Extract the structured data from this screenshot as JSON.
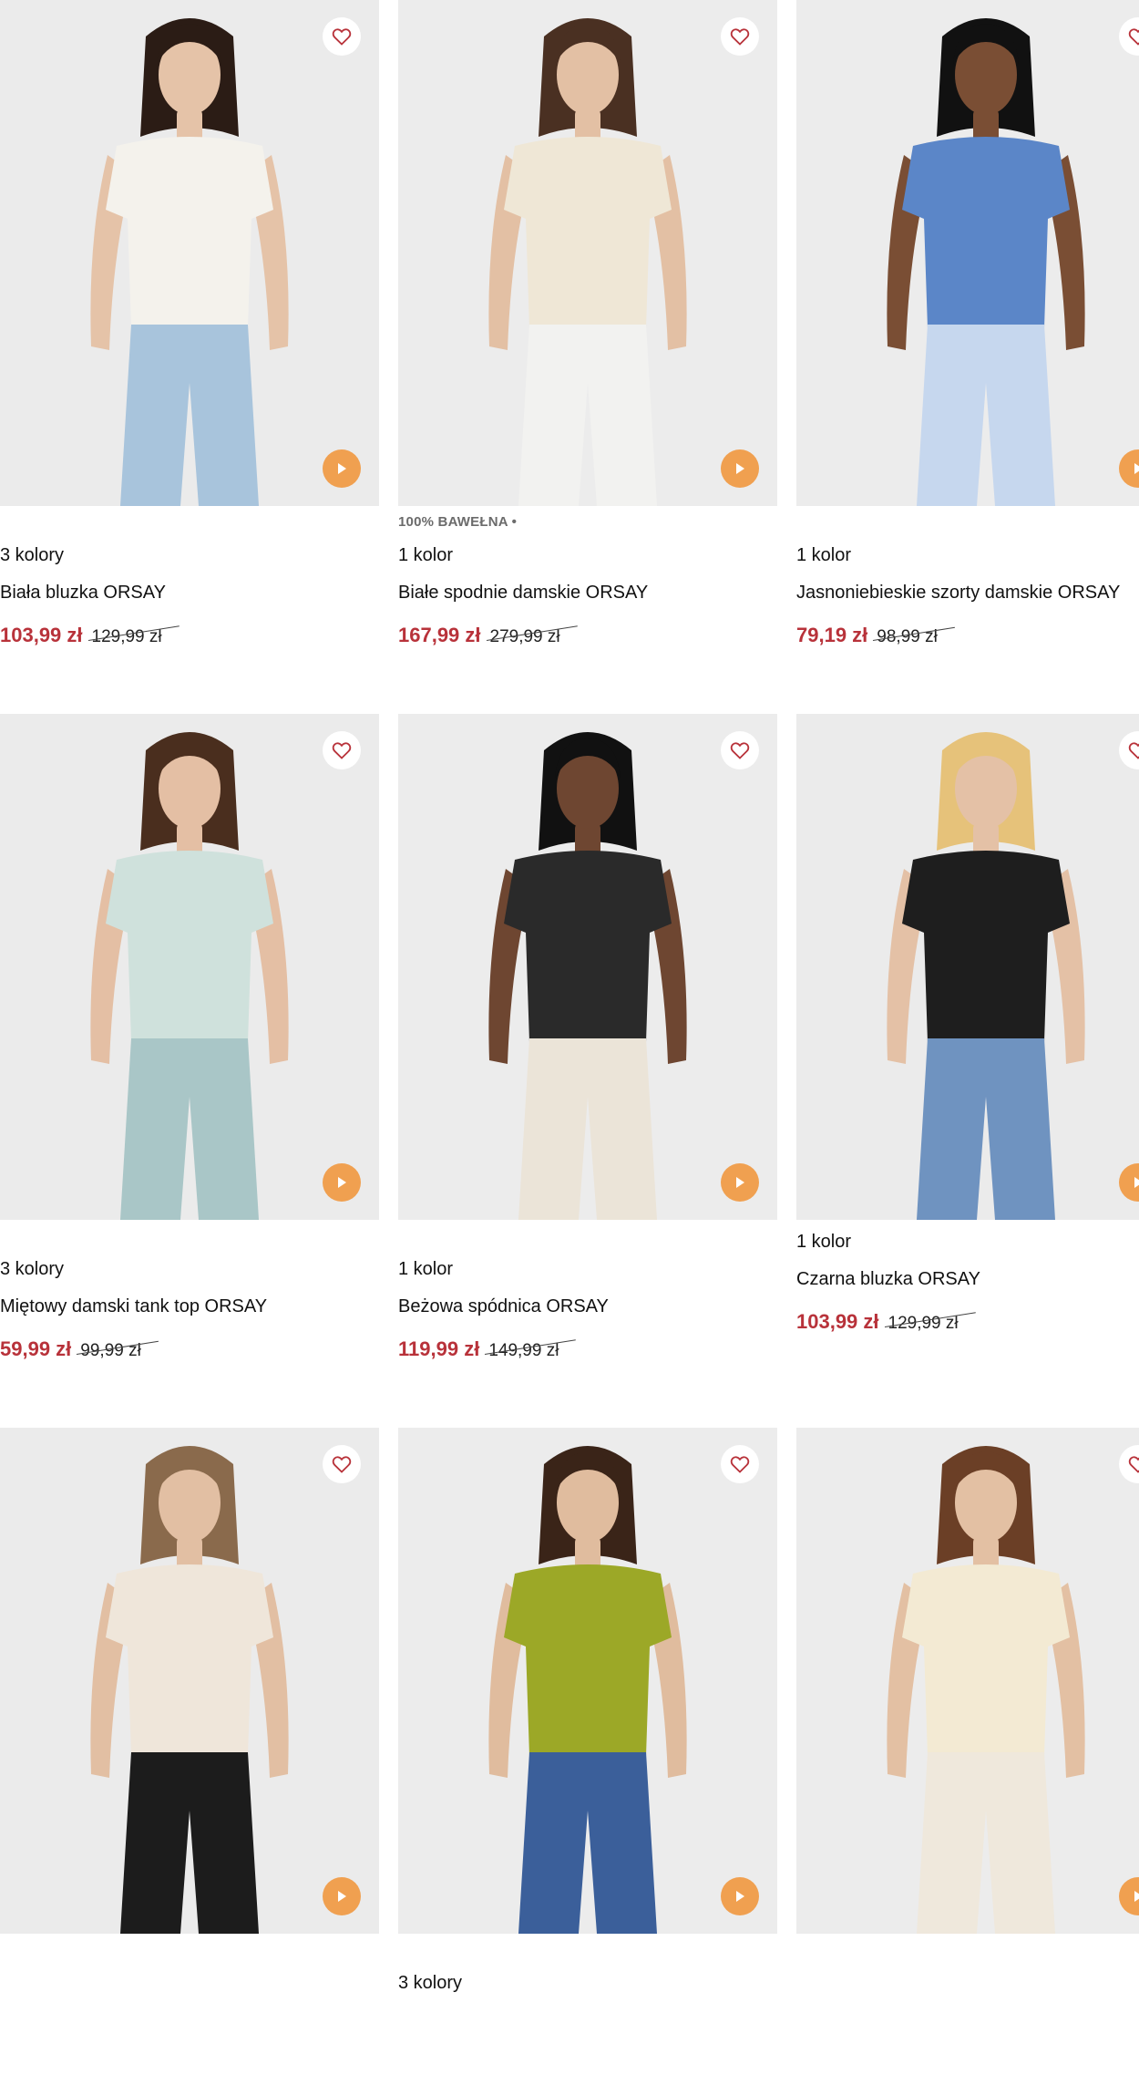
{
  "colors": {
    "price_sale": "#b8323a",
    "play_button": "#f0a050",
    "heart": "#b8323a",
    "image_bg": "#ededed"
  },
  "products": [
    {
      "tag": "",
      "colors_label": "3 kolory",
      "name": "Biała bluzka ORSAY",
      "price_new": "103,99 zł",
      "price_old": "129,99 zł",
      "palette": {
        "bg": "#ebebeb",
        "top": "#f4f2ec",
        "bottom": "#a8c4dc",
        "skin": "#e5c3a8",
        "hair": "#2b1c15"
      }
    },
    {
      "tag": "100% BAWEŁNA •",
      "colors_label": "1 kolor",
      "name": "Białe spodnie damskie ORSAY",
      "price_new": "167,99 zł",
      "price_old": "279,99 zł",
      "palette": {
        "bg": "#ececec",
        "top": "#efe7d6",
        "bottom": "#f2f2f0",
        "skin": "#e3c0a4",
        "hair": "#4a3022"
      }
    },
    {
      "tag": "",
      "colors_label": "1 kolor",
      "name": "Jasnoniebieskie szorty damskie ORSAY",
      "price_new": "79,19 zł",
      "price_old": "98,99 zł",
      "palette": {
        "bg": "#ececec",
        "top": "#5b86c8",
        "bottom": "#c6d7ee",
        "skin": "#7a4e34",
        "hair": "#111111"
      }
    },
    {
      "tag": "",
      "colors_label": "3 kolory",
      "name": "Miętowy damski tank top ORSAY",
      "price_new": "59,99 zł",
      "price_old": "99,99 zł",
      "palette": {
        "bg": "#ebebeb",
        "top": "#cfe1dc",
        "bottom": "#a9c6c7",
        "skin": "#e4bfa4",
        "hair": "#4a2e1e"
      }
    },
    {
      "tag": "",
      "colors_label": "1 kolor",
      "name": "Beżowa spódnica ORSAY",
      "price_new": "119,99 zł",
      "price_old": "149,99 zł",
      "palette": {
        "bg": "#ececec",
        "top": "#2a2a2a",
        "bottom": "#ebe4d8",
        "skin": "#6e4631",
        "hair": "#111111"
      }
    },
    {
      "tag": "",
      "colors_label": "1 kolor",
      "name": "Czarna bluzka ORSAY",
      "price_new": "103,99 zł",
      "price_old": "129,99 zł",
      "palette": {
        "bg": "#ebebeb",
        "top": "#1e1e1e",
        "bottom": "#6f93c0",
        "skin": "#e4c1a6",
        "hair": "#e6c27a"
      }
    },
    {
      "tag": "",
      "colors_label": "",
      "name": "",
      "price_new": "",
      "price_old": "",
      "palette": {
        "bg": "#ebebeb",
        "top": "#efe6da",
        "bottom": "#1c1c1c",
        "skin": "#e2bfa3",
        "hair": "#8a6a4c"
      }
    },
    {
      "tag": "",
      "colors_label": "3 kolory",
      "name": "",
      "price_new": "",
      "price_old": "",
      "palette": {
        "bg": "#ececec",
        "top": "#9ca827",
        "bottom": "#3b5f9a",
        "skin": "#e0bc9e",
        "hair": "#3a2418"
      }
    },
    {
      "tag": "",
      "colors_label": "",
      "name": "",
      "price_new": "",
      "price_old": "",
      "palette": {
        "bg": "#ececec",
        "top": "#f3ead3",
        "bottom": "#efe8dc",
        "skin": "#e3c0a3",
        "hair": "#6b3f26"
      }
    }
  ]
}
